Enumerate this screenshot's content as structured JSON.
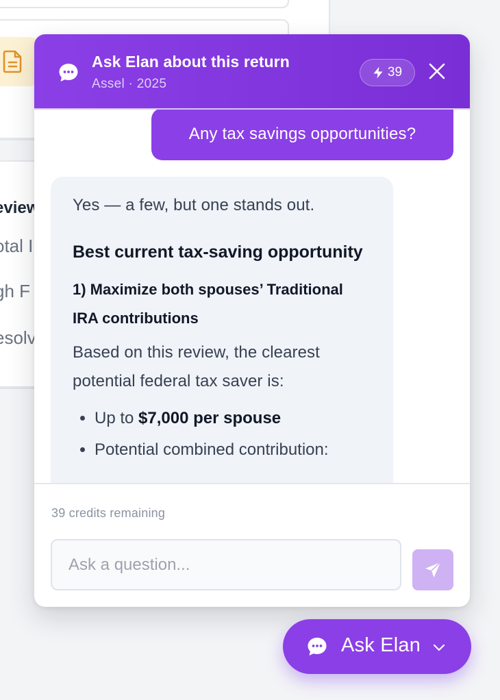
{
  "background": {
    "lines": [
      "eview",
      "otal I",
      "gh F",
      "esolv"
    ]
  },
  "chat": {
    "title": "Ask Elan about this return",
    "subtitle": "Assel · 2025",
    "credit_count": "39",
    "user_message": "Any tax savings opportunities?",
    "assistant": {
      "intro": "Yes — a few, but one stands out.",
      "heading": "Best current tax-saving opportunity",
      "subheading": "1) Maximize both spouses’ Traditional IRA contributions",
      "paragraph": "Based on this review, the clearest potential federal tax saver is:",
      "bullet_1_prefix": "Up to ",
      "bullet_1_bold": "$7,000 per spouse",
      "bullet_2": "Potential combined contribution:"
    },
    "credits_remaining": "39 credits remaining",
    "input_placeholder": "Ask a question..."
  },
  "fab": {
    "label": "Ask Elan"
  },
  "colors": {
    "brand_purple": "#8b3fe6",
    "send_disabled": "#cfb2f3",
    "bubble_bg": "#f0f3f8"
  },
  "icons": [
    "chat-bubble-icon",
    "lightning-icon",
    "close-icon",
    "send-icon",
    "chevron-down-icon",
    "document-icon"
  ]
}
